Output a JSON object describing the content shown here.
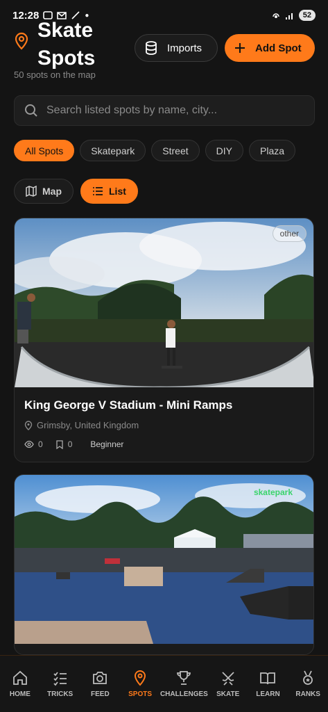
{
  "status_bar": {
    "time": "12:28",
    "battery": "52"
  },
  "header": {
    "title": "Skate Spots",
    "subtitle": "50 spots on the map",
    "imports_label": "Imports",
    "add_label": "Add Spot"
  },
  "search": {
    "placeholder": "Search listed spots by name, city..."
  },
  "filters": [
    "All Spots",
    "Skatepark",
    "Street",
    "DIY",
    "Plaza"
  ],
  "view": {
    "map_label": "Map",
    "list_label": "List"
  },
  "spots": [
    {
      "tag": "other",
      "title": "King George V Stadium - Mini Ramps",
      "location": "Grimsby, United Kingdom",
      "views": "0",
      "saves": "0",
      "level": "Beginner"
    },
    {
      "tag": "skatepark"
    }
  ],
  "nav": [
    "HOME",
    "TRICKS",
    "FEED",
    "SPOTS",
    "CHALLENGES",
    "SKATE",
    "LEARN",
    "RANKS"
  ],
  "colors": {
    "accent": "#ff7a1a",
    "background": "#141414",
    "card": "#1a1a1a"
  }
}
